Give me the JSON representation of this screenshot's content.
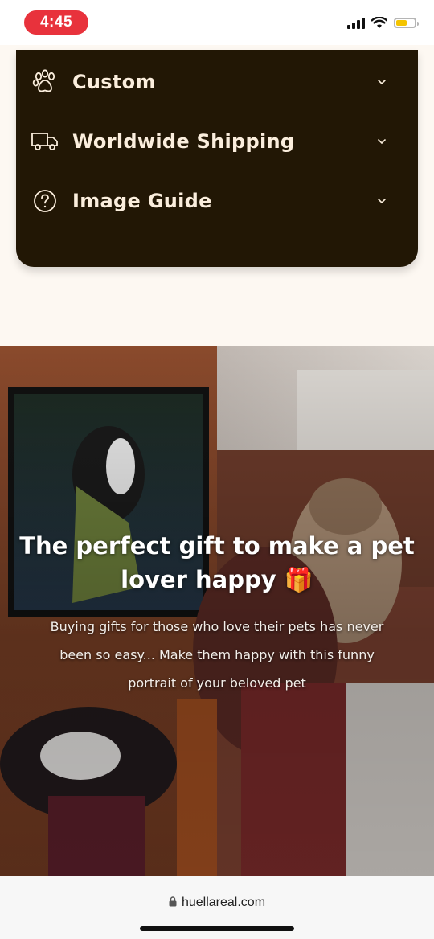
{
  "status_bar": {
    "time": "4:45",
    "icons": [
      "cellular-signal-icon",
      "wifi-icon",
      "battery-icon"
    ],
    "battery_color": "#f4c400",
    "time_pill_color": "#e8323c"
  },
  "accordion": {
    "background": "#221705",
    "items": [
      {
        "label": "Custom",
        "icon": "paw-icon"
      },
      {
        "label": "Worldwide Shipping",
        "icon": "truck-icon"
      },
      {
        "label": "Image Guide",
        "icon": "question-circle-icon"
      }
    ]
  },
  "hero": {
    "title": "The perfect gift to make a pet lover happy 🎁",
    "subtitle": "Buying gifts for those who love their pets has never been so easy... Make them happy with this funny portrait of your beloved pet"
  },
  "browser": {
    "url": "huellareal.com",
    "icon": "lock-icon"
  }
}
